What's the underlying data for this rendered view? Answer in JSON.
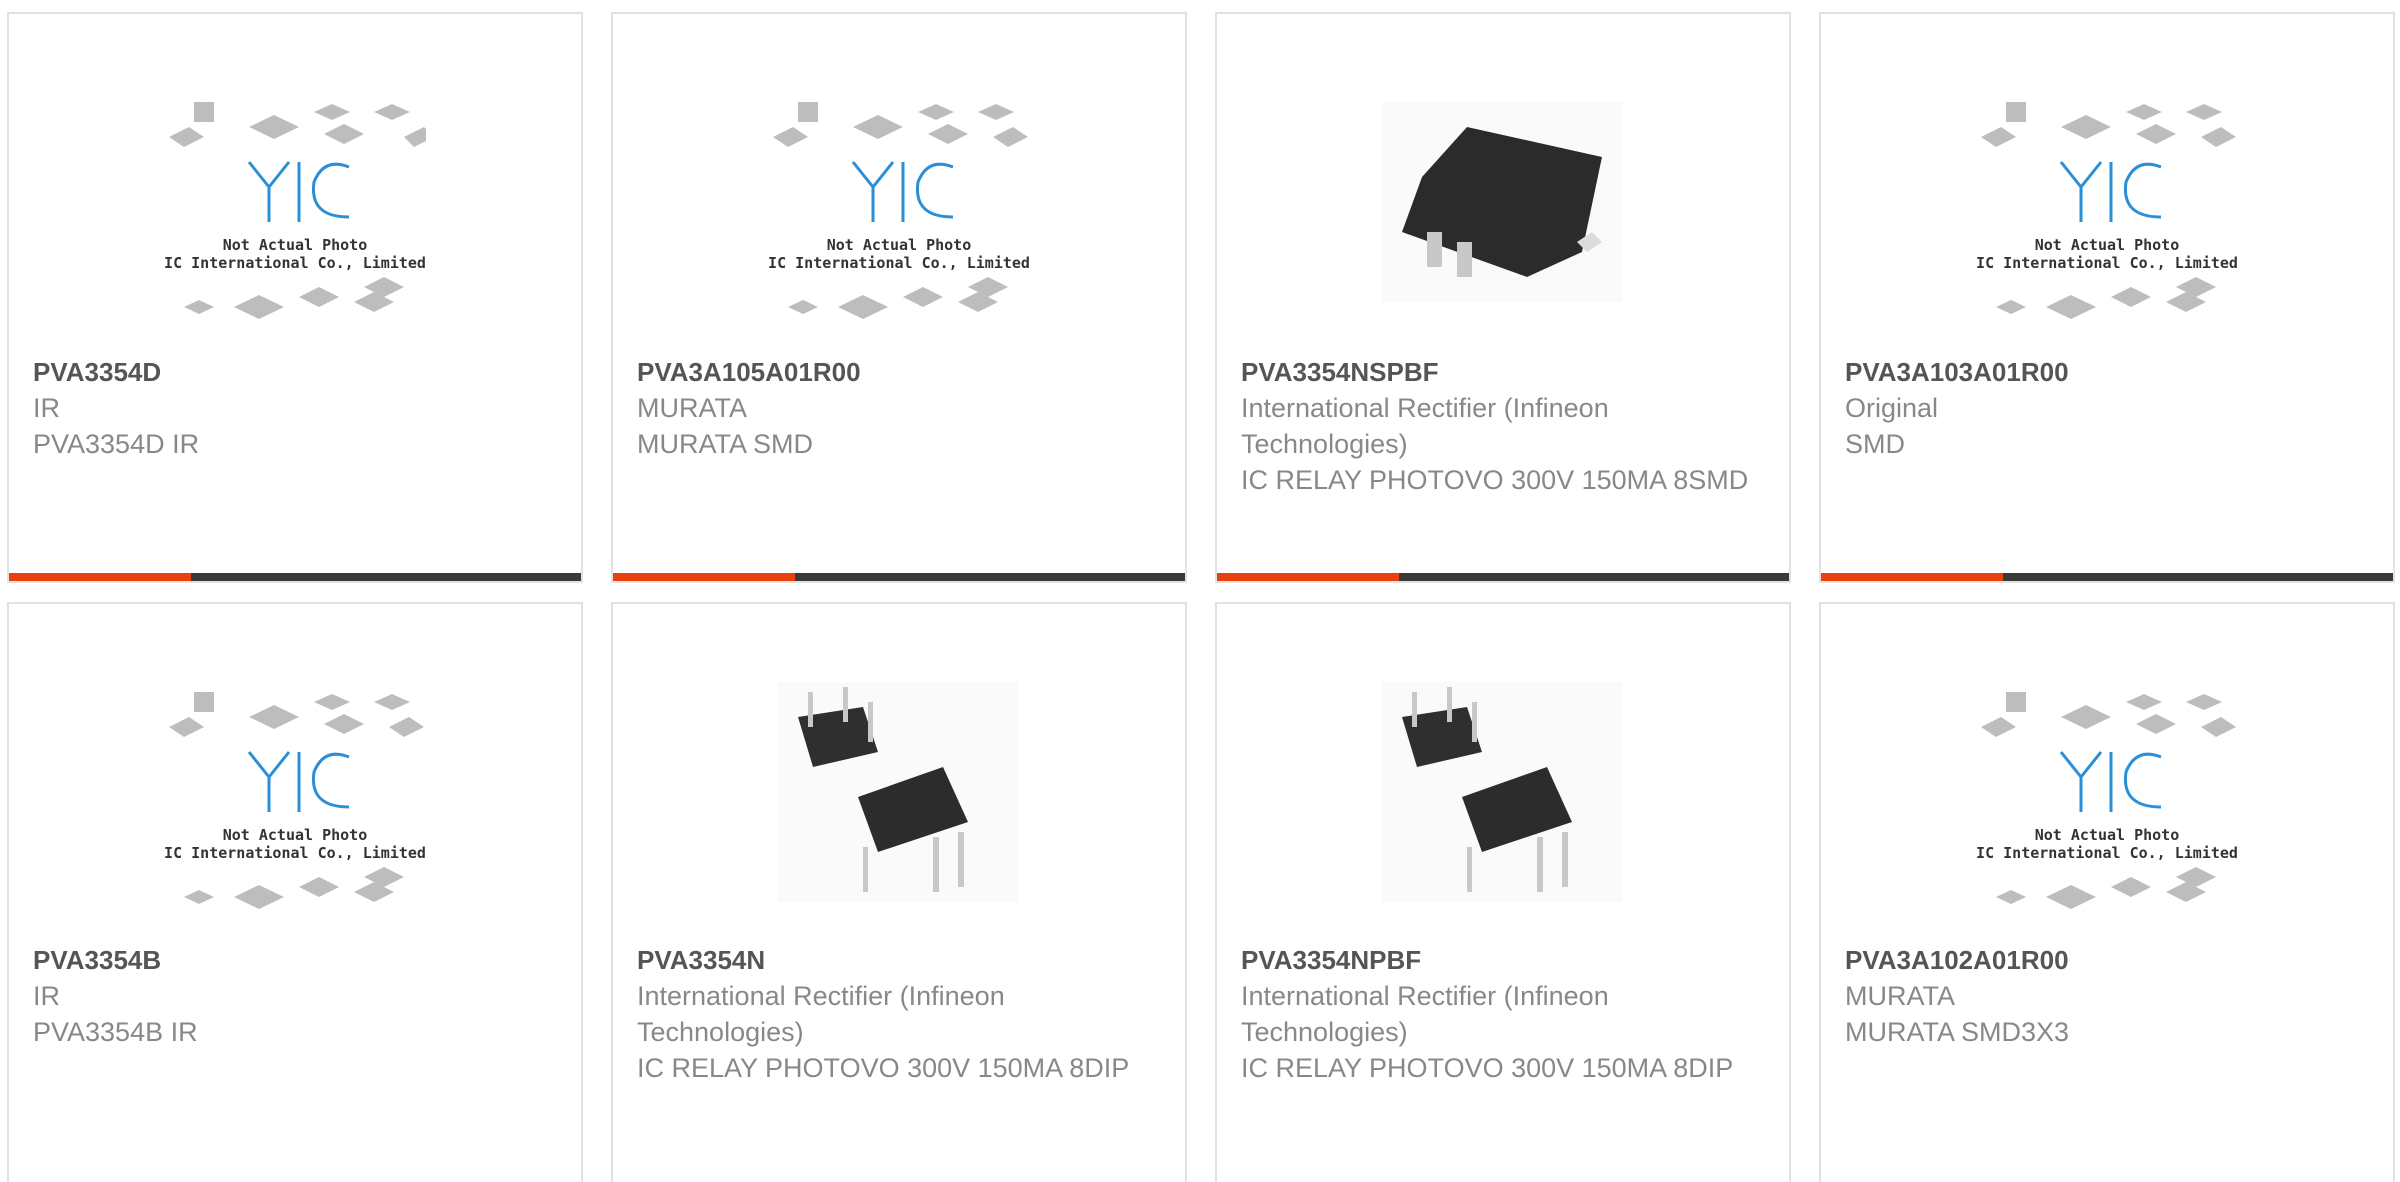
{
  "colors": {
    "accent": "#e8410e",
    "bar": "#3a3a3a",
    "border": "#e2e2e2",
    "logo": "#2a8fd6"
  },
  "products": [
    {
      "part_number": "PVA3354D",
      "manufacturer": "IR",
      "description": "PVA3354D IR",
      "image": "placeholder",
      "placeholder_line1": "Not Actual Photo",
      "placeholder_line2": "YIC International Co., Limited."
    },
    {
      "part_number": "PVA3A105A01R00",
      "manufacturer": "MURATA",
      "description": "MURATA SMD",
      "image": "placeholder",
      "placeholder_line1": "Not Actual Photo",
      "placeholder_line2": "YIC International Co., Limited."
    },
    {
      "part_number": "PVA3354NSPBF",
      "manufacturer": "International Rectifier (Infineon Technologies)",
      "description": "IC RELAY PHOTOVO 300V 150MA 8SMD",
      "image": "smd-chip"
    },
    {
      "part_number": "PVA3A103A01R00",
      "manufacturer": "Original",
      "description": "SMD",
      "image": "placeholder",
      "placeholder_line1": "Not Actual Photo",
      "placeholder_line2": "YIC International Co., Limited."
    },
    {
      "part_number": "PVA3354B",
      "manufacturer": "IR",
      "description": "PVA3354B IR",
      "image": "placeholder",
      "placeholder_line1": "Not Actual Photo",
      "placeholder_line2": "YIC International Co., Limited."
    },
    {
      "part_number": "PVA3354N",
      "manufacturer": "International Rectifier (Infineon Technologies)",
      "description": "IC RELAY PHOTOVO 300V 150MA 8DIP",
      "image": "dip-chip"
    },
    {
      "part_number": "PVA3354NPBF",
      "manufacturer": "International Rectifier (Infineon Technologies)",
      "description": "IC RELAY PHOTOVO 300V 150MA 8DIP",
      "image": "dip-chip"
    },
    {
      "part_number": "PVA3A102A01R00",
      "manufacturer": "MURATA",
      "description": "MURATA SMD3X3",
      "image": "placeholder",
      "placeholder_line1": "Not Actual Photo",
      "placeholder_line2": "YIC International Co., Limited."
    }
  ]
}
